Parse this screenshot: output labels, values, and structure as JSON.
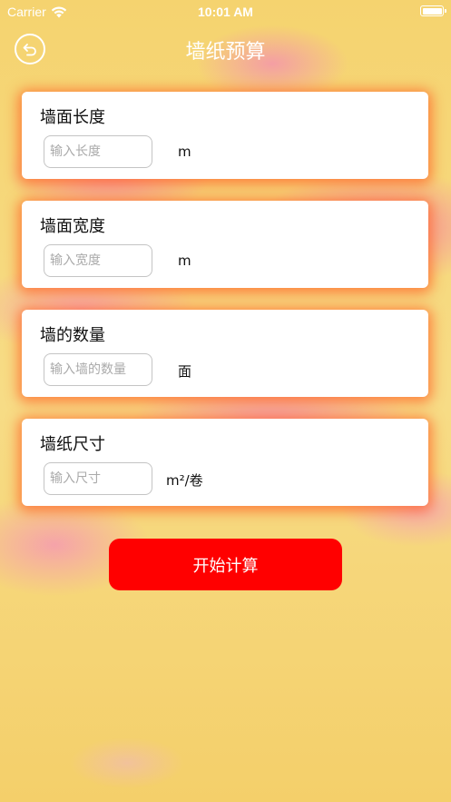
{
  "status_bar": {
    "carrier": "Carrier",
    "time": "10:01 AM",
    "icons": [
      "wifi-icon",
      "battery-icon"
    ]
  },
  "nav": {
    "title": "墙纸预算",
    "back_icon": "back-arrow-icon"
  },
  "cards": [
    {
      "label": "墙面长度",
      "placeholder": "输入长度",
      "value": "",
      "unit": "m"
    },
    {
      "label": "墙面宽度",
      "placeholder": "输入宽度",
      "value": "",
      "unit": "m"
    },
    {
      "label": "墙的数量",
      "placeholder": "输入墙的数量",
      "value": "",
      "unit": "面"
    },
    {
      "label": "墙纸尺寸",
      "placeholder": "输入尺寸",
      "value": "",
      "unit": "m²/卷"
    }
  ],
  "actions": {
    "calculate_label": "开始计算"
  },
  "colors": {
    "background": "#f6d67a",
    "accent_pink": "#f48cb4",
    "card_shadow": "#ff6428",
    "button": "#ff0000",
    "text_on_dark": "#ffffff"
  }
}
